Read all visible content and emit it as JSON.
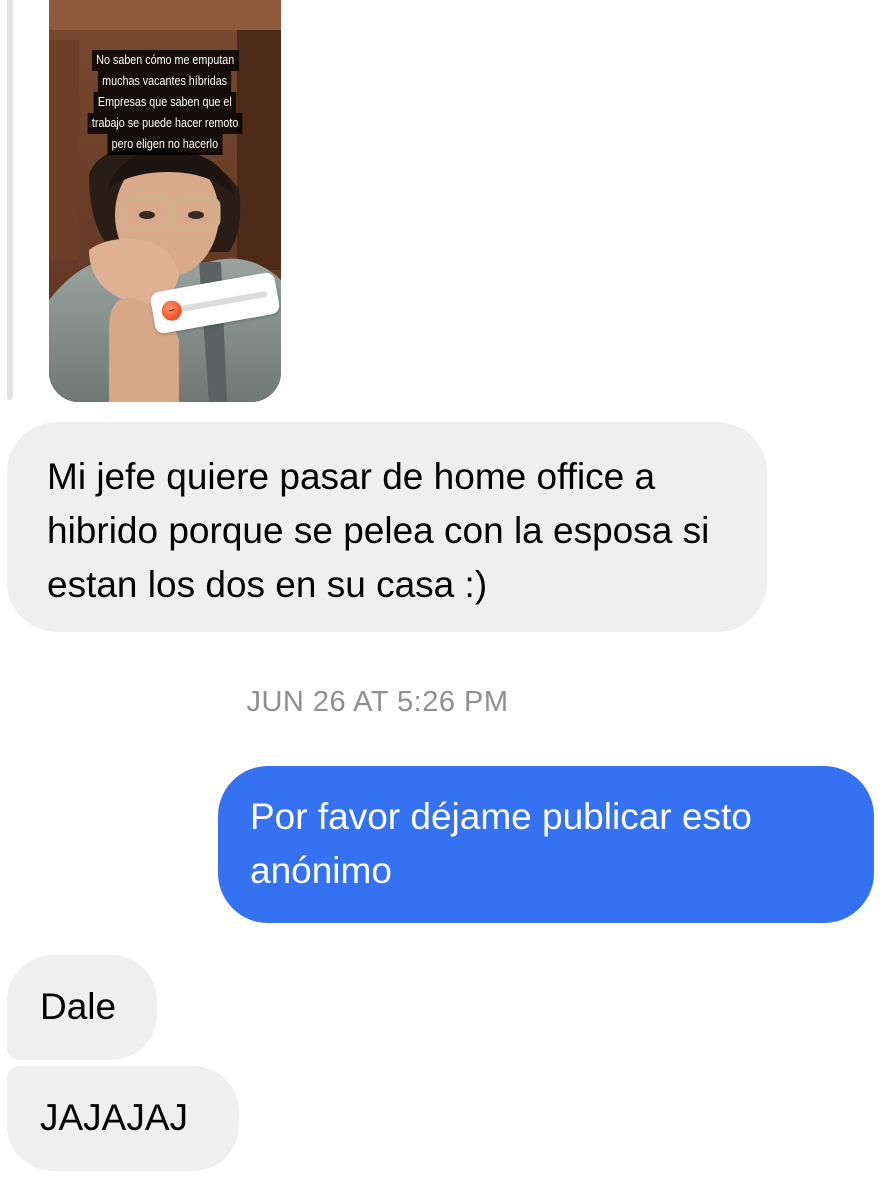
{
  "story_reply": {
    "caption_lines": [
      "No saben cómo me emputan",
      "muchas vacantes híbridas",
      "Empresas que saben que el",
      "trabajo se puede hacer remoto",
      "pero eligen no hacerlo"
    ],
    "slider_emoji_icon": "angry-face-icon",
    "slider_value": 0.0
  },
  "messages": [
    {
      "direction": "received",
      "text": "Mi jefe quiere pasar de home office a hibrido porque se pelea con la esposa si estan los dos en su casa :)"
    },
    {
      "direction": "sent",
      "text": "Por favor déjame publicar esto anónimo"
    },
    {
      "direction": "received",
      "text": "Dale"
    },
    {
      "direction": "received",
      "text": "JAJAJAJ"
    }
  ],
  "timestamp": "JUN 26 AT 5:26 PM",
  "colors": {
    "sent_bubble": "#3572f2",
    "received_bubble": "#efefef",
    "timestamp_text": "#8e8e93"
  }
}
